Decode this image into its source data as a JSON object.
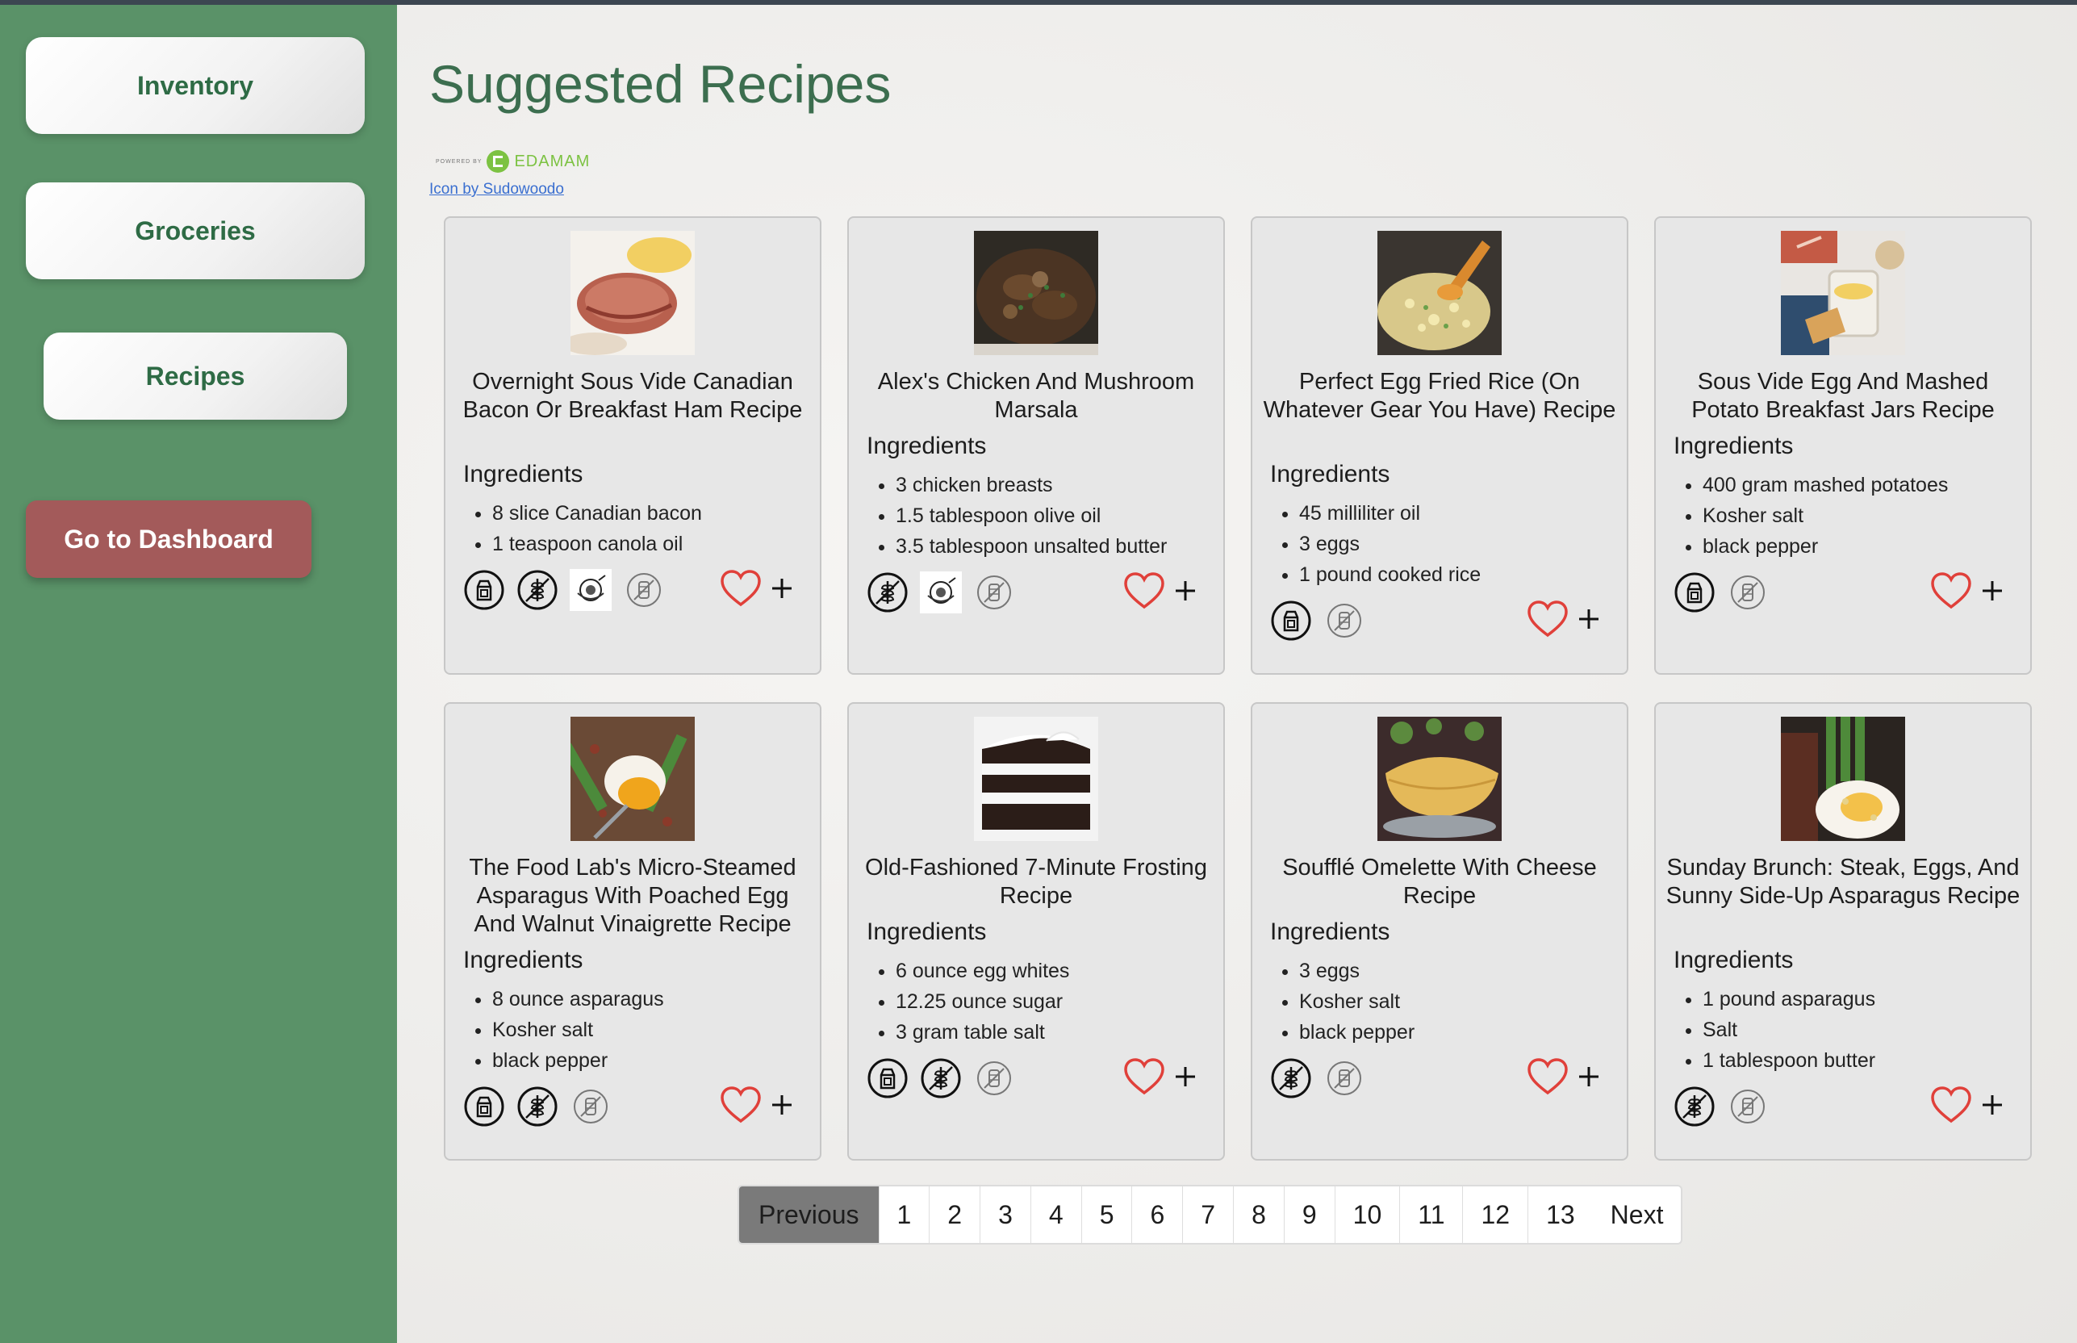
{
  "sidebar": {
    "nav": [
      {
        "label": "Inventory"
      },
      {
        "label": "Groceries"
      },
      {
        "label": "Recipes"
      }
    ],
    "dashboard_label": "Go to Dashboard"
  },
  "main": {
    "title": "Suggested Recipes",
    "edamam": {
      "powered": "POWERED BY",
      "brand": "EDAMAM"
    },
    "credit": "Icon by Sudowoodo"
  },
  "recipes": [
    {
      "title": "Overnight Sous Vide Canadian Bacon Or Breakfast Ham Recipe",
      "ingredients_label": "Ingredients",
      "ingredients": [
        "8 slice Canadian bacon",
        "1 teaspoon canola oil"
      ],
      "diet_icons": [
        "dairy-free-icon",
        "gluten-free-icon",
        "low-sodium-icon",
        "sugar-free-icon"
      ]
    },
    {
      "title": "Alex's Chicken And Mushroom Marsala",
      "ingredients_label": "Ingredients",
      "ingredients": [
        "3 chicken breasts",
        "1.5 tablespoon olive oil",
        "3.5 tablespoon unsalted butter"
      ],
      "diet_icons": [
        "gluten-free-icon",
        "low-sodium-icon",
        "sugar-free-icon"
      ]
    },
    {
      "title": "Perfect Egg Fried Rice (On Whatever Gear You Have) Recipe",
      "ingredients_label": "Ingredients",
      "ingredients": [
        "45 milliliter oil",
        "3 eggs",
        "1 pound cooked rice"
      ],
      "diet_icons": [
        "dairy-free-icon",
        "sugar-free-icon"
      ]
    },
    {
      "title": "Sous Vide Egg And Mashed Potato Breakfast Jars Recipe",
      "ingredients_label": "Ingredients",
      "ingredients": [
        "400 gram mashed potatoes",
        "Kosher salt",
        "black pepper"
      ],
      "diet_icons": [
        "dairy-free-icon",
        "sugar-free-icon"
      ]
    },
    {
      "title": "The Food Lab's Micro-Steamed Asparagus With Poached Egg And Walnut Vinaigrette Recipe",
      "ingredients_label": "Ingredients",
      "ingredients": [
        "8 ounce asparagus",
        "Kosher salt",
        "black pepper"
      ],
      "diet_icons": [
        "dairy-free-icon",
        "gluten-free-icon",
        "sugar-free-icon"
      ]
    },
    {
      "title": "Old-Fashioned 7-Minute Frosting Recipe",
      "ingredients_label": "Ingredients",
      "ingredients": [
        "6 ounce egg whites",
        "12.25 ounce sugar",
        "3 gram table salt"
      ],
      "diet_icons": [
        "dairy-free-icon",
        "gluten-free-icon",
        "sugar-free-icon"
      ]
    },
    {
      "title": "Soufflé Omelette With Cheese Recipe",
      "ingredients_label": "Ingredients",
      "ingredients": [
        "3 eggs",
        "Kosher salt",
        "black pepper"
      ],
      "diet_icons": [
        "gluten-free-icon",
        "sugar-free-icon"
      ]
    },
    {
      "title": "Sunday Brunch: Steak, Eggs, And Sunny Side-Up Asparagus Recipe",
      "ingredients_label": "Ingredients",
      "ingredients": [
        "1 pound asparagus",
        "Salt",
        "1 tablespoon butter"
      ],
      "diet_icons": [
        "gluten-free-icon",
        "sugar-free-icon"
      ]
    }
  ],
  "pagination": {
    "previous": "Previous",
    "pages": [
      "1",
      "2",
      "3",
      "4",
      "5",
      "6",
      "7",
      "8",
      "9",
      "10",
      "11",
      "12",
      "13"
    ],
    "next": "Next"
  },
  "colors": {
    "sidebar": "#5a9268",
    "title": "#3c6e4f",
    "dashboard_button": "#a35a5a",
    "heart": "#e0403a",
    "pagination_active": "#7a7a7a"
  }
}
